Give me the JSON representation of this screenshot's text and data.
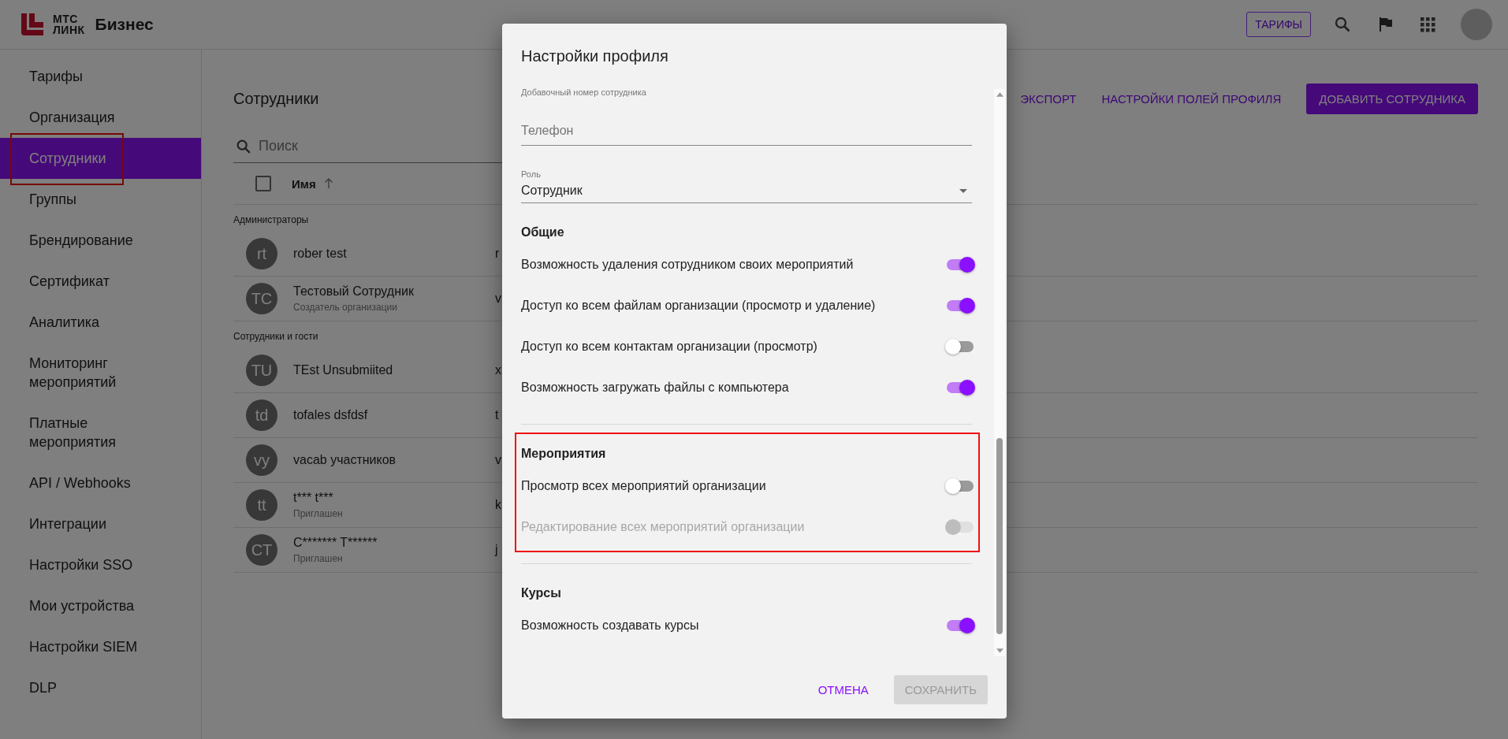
{
  "header": {
    "logo_top": "МТС",
    "logo_bottom": "ЛИНК",
    "product": "Бизнес",
    "tariffs_button": "ТАРИФЫ"
  },
  "sidebar": {
    "items": [
      {
        "label": "Тарифы",
        "selected": false,
        "highlighted": false
      },
      {
        "label": "Организация",
        "selected": false,
        "highlighted": false
      },
      {
        "label": "Сотрудники",
        "selected": true,
        "highlighted": true
      },
      {
        "label": "Группы",
        "selected": false,
        "highlighted": false
      },
      {
        "label": "Брендирование",
        "selected": false,
        "highlighted": false
      },
      {
        "label": "Сертификат",
        "selected": false,
        "highlighted": false
      },
      {
        "label": "Аналитика",
        "selected": false,
        "highlighted": false
      },
      {
        "label": "Мониторинг мероприятий",
        "selected": false,
        "highlighted": false
      },
      {
        "label": "Платные мероприятия",
        "selected": false,
        "highlighted": false
      },
      {
        "label": "API / Webhooks",
        "selected": false,
        "highlighted": false
      },
      {
        "label": "Интеграции",
        "selected": false,
        "highlighted": false
      },
      {
        "label": "Настройки SSO",
        "selected": false,
        "highlighted": false
      },
      {
        "label": "Мои устройства",
        "selected": false,
        "highlighted": false
      },
      {
        "label": "Настройки SIEM",
        "selected": false,
        "highlighted": false
      },
      {
        "label": "DLP",
        "selected": false,
        "highlighted": false
      }
    ]
  },
  "page": {
    "title": "Сотрудники",
    "search": {
      "placeholder": "Поиск"
    },
    "actions": [
      {
        "label": "ЭКСПОРТ",
        "kind": "text"
      },
      {
        "label": "НАСТРОЙКИ ПОЛЕЙ ПРОФИЛЯ",
        "kind": "text"
      },
      {
        "label": "ДОБАВИТЬ СОТРУДНИКА",
        "kind": "filled"
      }
    ],
    "table": {
      "select_all": {
        "checked": false
      },
      "columns": [
        "Имя"
      ],
      "groups": [
        {
          "title": "Администраторы",
          "rows": [
            {
              "initials": "rt",
              "name": "rober test",
              "column_2": "r"
            },
            {
              "initials": "TC",
              "name": "Тестовый Сотрудник",
              "subtitle": "Создатель организации",
              "column_2": "v"
            }
          ]
        },
        {
          "title": "Сотрудники и гости",
          "rows": [
            {
              "initials": "TU",
              "name": "TEst Unsubmiited",
              "column_2": "x"
            },
            {
              "initials": "td",
              "name": "tofales dsfdsf",
              "column_2": "t"
            },
            {
              "initials": "vy",
              "name": "vacab участников",
              "column_2": "v"
            },
            {
              "initials": "tt",
              "name": "t*** t***",
              "subtitle": "Приглашен",
              "column_2": "k"
            },
            {
              "initials": "CT",
              "name": "C******* T******",
              "subtitle": "Приглашен",
              "column_2": "j"
            }
          ]
        }
      ]
    }
  },
  "dialog": {
    "title": "Настройки профиля",
    "extension_label": "Добавочный номер сотрудника",
    "phone": {
      "placeholder": "Телефон"
    },
    "role": {
      "label": "Роль",
      "value": "Сотрудник"
    },
    "sections": [
      {
        "title": "Общие",
        "items": [
          {
            "label": "Возможность удаления сотрудником своих мероприятий",
            "on": true,
            "disabled": false
          },
          {
            "label": "Доступ ко всем файлам организации (просмотр и удаление)",
            "on": true,
            "disabled": false
          },
          {
            "label": "Доступ ко всем контактам организации (просмотр)",
            "on": false,
            "disabled": false
          },
          {
            "label": "Возможность загружать файлы с компьютера",
            "on": true,
            "disabled": false
          }
        ]
      },
      {
        "title": "Мероприятия",
        "highlighted": true,
        "items": [
          {
            "label": "Просмотр всех мероприятий организации",
            "on": false,
            "disabled": false
          },
          {
            "label": "Редактирование всех мероприятий организации",
            "on": false,
            "disabled": true
          }
        ]
      },
      {
        "title": "Курсы",
        "items": [
          {
            "label": "Возможность создавать курсы",
            "on": true,
            "disabled": false
          }
        ]
      }
    ],
    "buttons": [
      {
        "label": "ОТМЕНА",
        "kind": "text",
        "disabled": false
      },
      {
        "label": "СОХРАНИТЬ",
        "kind": "filled",
        "disabled": true
      }
    ]
  }
}
